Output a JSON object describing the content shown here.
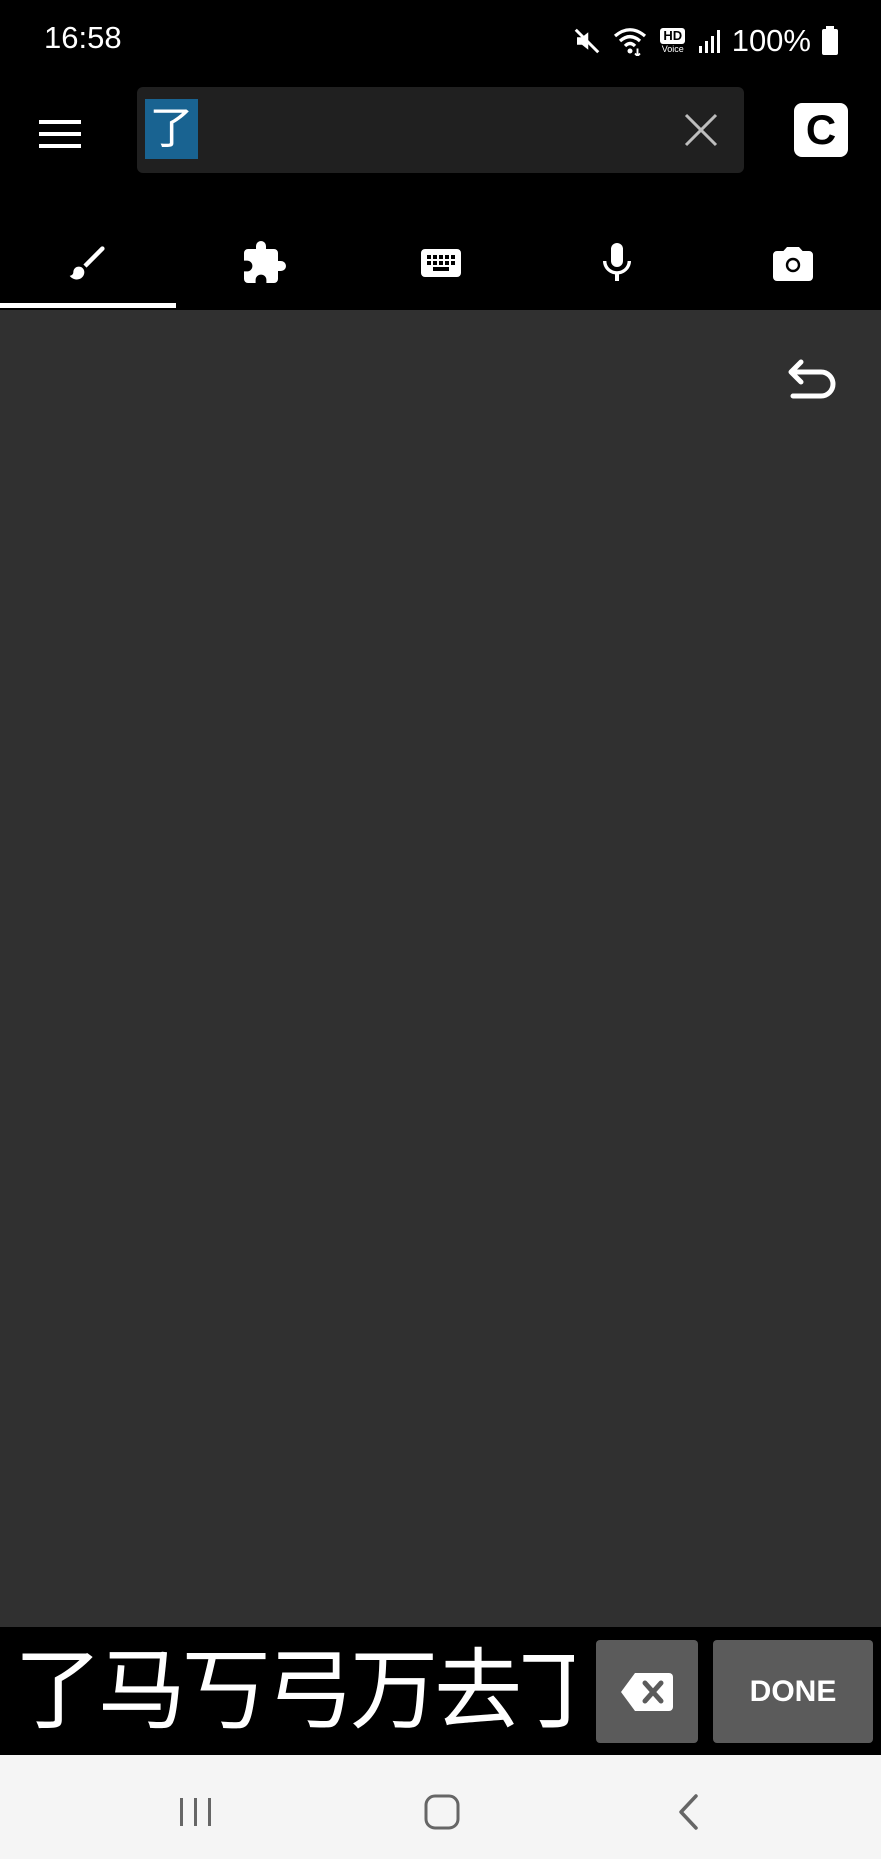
{
  "status_bar": {
    "time": "16:58",
    "battery_text": "100%",
    "icons": [
      "mute-icon",
      "wifi-icon",
      "hd-voice-icon",
      "signal-icon",
      "battery-icon"
    ],
    "hd_label": "HD",
    "voice_label": "Voice"
  },
  "search": {
    "value": "了",
    "clear_icon": "close-icon",
    "menu_icon": "hamburger-menu-icon",
    "c_button_label": "C"
  },
  "tabs": [
    {
      "name": "handwriting",
      "icon": "brush-icon",
      "active": true
    },
    {
      "name": "radicals",
      "icon": "puzzle-icon",
      "active": false
    },
    {
      "name": "keyboard",
      "icon": "keyboard-icon",
      "active": false
    },
    {
      "name": "voice",
      "icon": "microphone-icon",
      "active": false
    },
    {
      "name": "camera",
      "icon": "camera-icon",
      "active": false
    }
  ],
  "canvas": {
    "undo_icon": "undo-icon"
  },
  "candidates": {
    "items": [
      "了",
      "马",
      "丂",
      "弓",
      "万",
      "去",
      "丁"
    ],
    "backspace_icon": "backspace-icon",
    "done_label": "DONE"
  },
  "colors": {
    "background": "#000000",
    "canvas": "#303030",
    "search_box": "#202020",
    "selection_highlight": "#196391",
    "button_gray": "#5b5b5b",
    "nav_bar": "#f5f5f5"
  }
}
